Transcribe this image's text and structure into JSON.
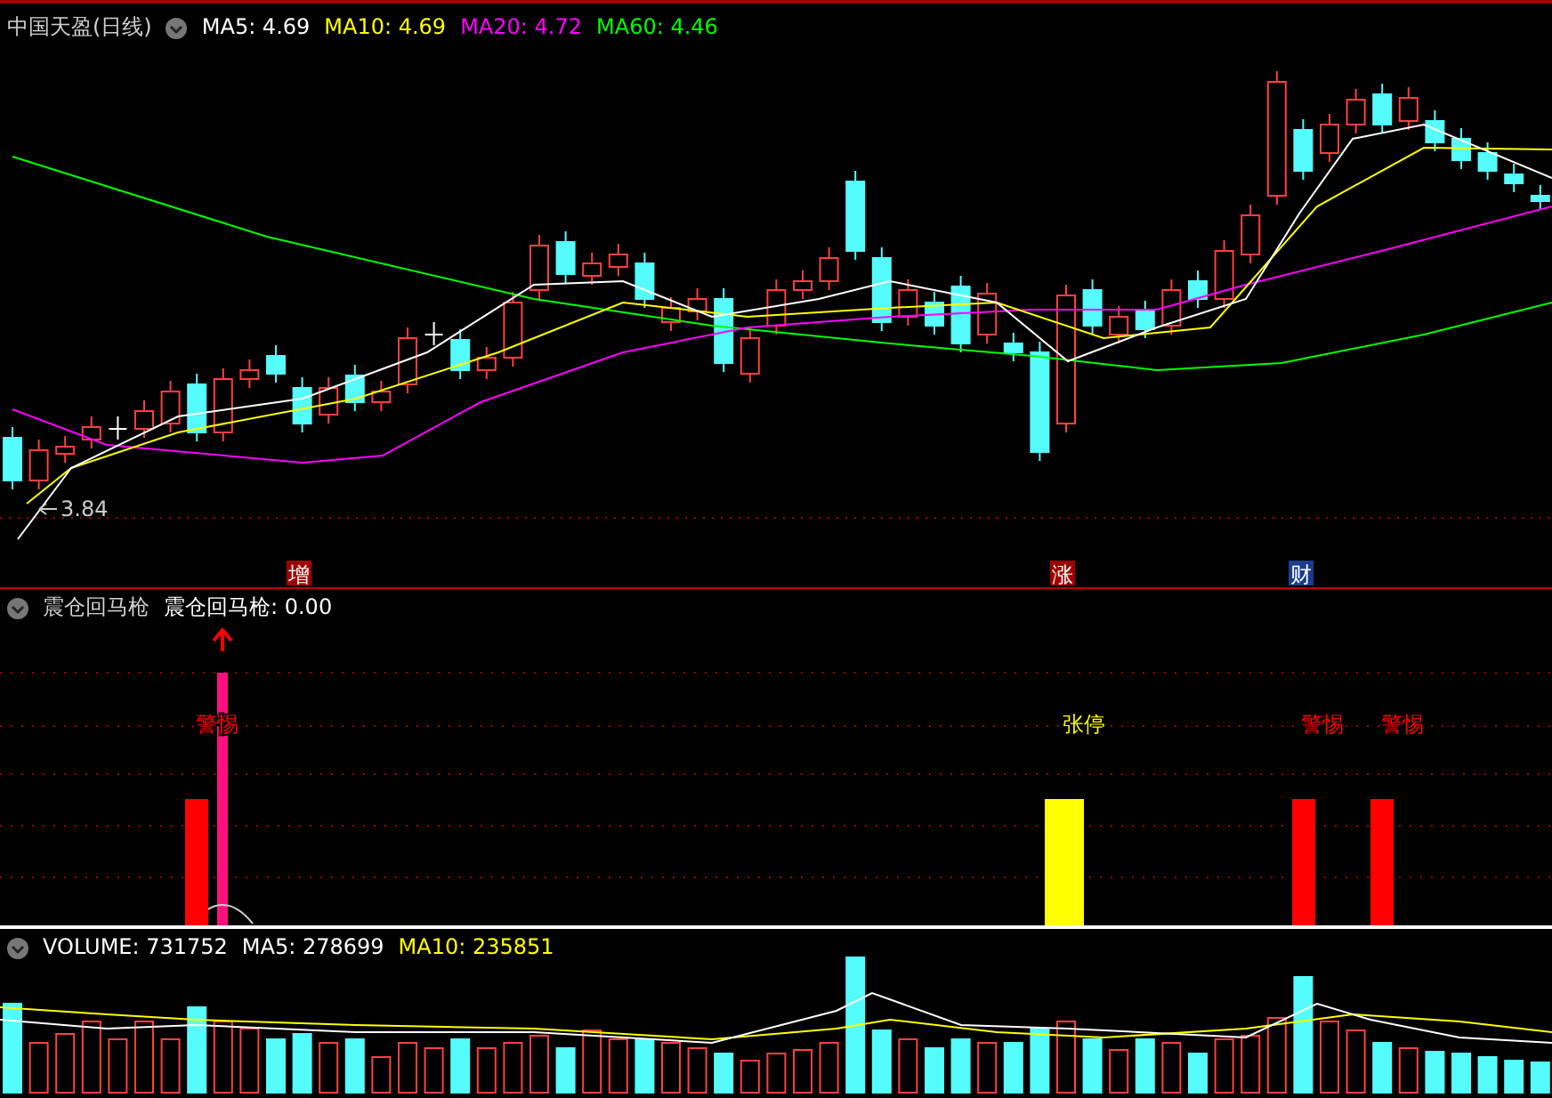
{
  "price_panel": {
    "title": "中国天盈(日线)",
    "indicators": [
      {
        "label": "MA5: 4.69",
        "color": "#ffffff"
      },
      {
        "label": "MA10: 4.69",
        "color": "#ffff00"
      },
      {
        "label": "MA20: 4.72",
        "color": "#ff00ff"
      },
      {
        "label": "MA60: 4.46",
        "color": "#00ff00"
      }
    ],
    "low_label": "3.84",
    "markers": [
      {
        "label": "增",
        "color": "#a00000"
      },
      {
        "label": "涨",
        "color": "#a00000"
      },
      {
        "label": "财",
        "color": "#1a3c8c"
      }
    ]
  },
  "signal_panel": {
    "title": "震仓回马枪",
    "reading": "震仓回马枪: 0.00",
    "signals": [
      {
        "label": "警惕",
        "color": "#ff0000"
      },
      {
        "label": "张停",
        "color": "#ffff00"
      },
      {
        "label": "警惕",
        "color": "#ff0000"
      },
      {
        "label": "警惕",
        "color": "#ff0000"
      }
    ]
  },
  "volume_panel": {
    "indicators": [
      {
        "label": "VOLUME: 731752",
        "color": "#ffffff"
      },
      {
        "label": "MA5: 278699",
        "color": "#ffffff"
      },
      {
        "label": "MA10: 235851",
        "color": "#ffff00"
      }
    ]
  }
}
